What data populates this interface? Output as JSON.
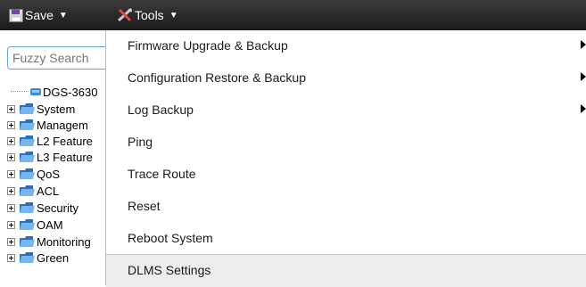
{
  "toolbar": {
    "save_label": "Save",
    "tools_label": "Tools",
    "caret": "▼"
  },
  "sidebar": {
    "search_placeholder": "Fuzzy Search",
    "root_label": "DGS-3630",
    "items": [
      {
        "label": "System"
      },
      {
        "label": "Managem"
      },
      {
        "label": "L2 Feature"
      },
      {
        "label": "L3 Feature"
      },
      {
        "label": "QoS"
      },
      {
        "label": "ACL"
      },
      {
        "label": "Security"
      },
      {
        "label": "OAM"
      },
      {
        "label": "Monitoring"
      },
      {
        "label": "Green"
      }
    ]
  },
  "tools_menu": {
    "items": [
      {
        "label": "Firmware Upgrade & Backup",
        "submenu": true
      },
      {
        "label": "Configuration Restore & Backup",
        "submenu": true
      },
      {
        "label": "Log Backup",
        "submenu": true
      },
      {
        "label": "Ping",
        "submenu": false
      },
      {
        "label": "Trace Route",
        "submenu": false
      },
      {
        "label": "Reset",
        "submenu": false
      },
      {
        "label": "Reboot System",
        "submenu": false
      },
      {
        "label": "DLMS Settings",
        "submenu": false,
        "highlighted": true
      }
    ]
  },
  "colors": {
    "toolbar_bg": "#1f1f1f",
    "search_border": "#6aa5d8",
    "folder": "#4a90d9",
    "highlight_bg": "#ececec"
  }
}
